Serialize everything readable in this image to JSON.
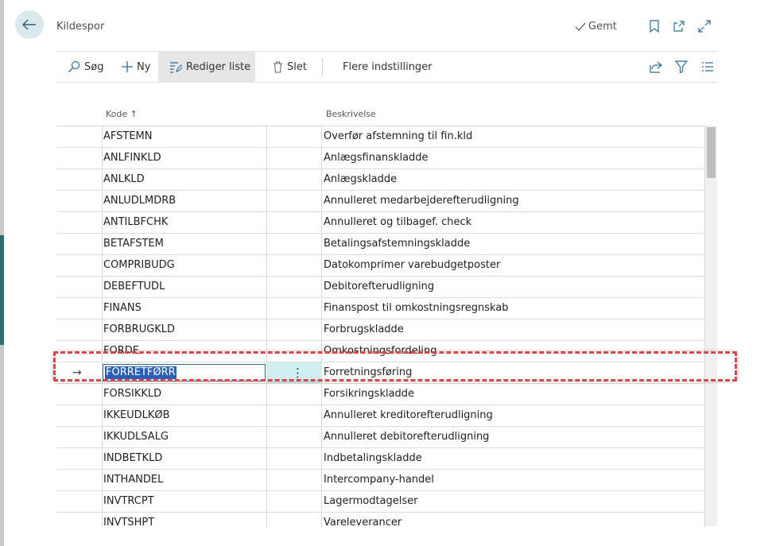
{
  "header": {
    "title": "Kildespor",
    "saved_label": "Gemt"
  },
  "toolbar": {
    "search_label": "Søg",
    "new_label": "Ny",
    "edit_list_label": "Rediger liste",
    "delete_label": "Slet",
    "more_settings_label": "Flere indstillinger"
  },
  "columns": {
    "code": "Kode ↑",
    "description": "Beskrivelse"
  },
  "rows": [
    {
      "code": "AFSTEMN",
      "desc": "Overfør afstemning til fin.kld"
    },
    {
      "code": "ANLFINKLD",
      "desc": "Anlægsfinanskladde"
    },
    {
      "code": "ANLKLD",
      "desc": "Anlægskladde"
    },
    {
      "code": "ANLUDLMDRB",
      "desc": "Annulleret medarbejderefterudligning"
    },
    {
      "code": "ANTILBFCHK",
      "desc": "Annulleret og tilbagef. check"
    },
    {
      "code": "BETAFSTEM",
      "desc": "Betalingsafstemningskladde"
    },
    {
      "code": "COMPRIBUDG",
      "desc": "Datokomprimer varebudgetposter"
    },
    {
      "code": "DEBEFTUDL",
      "desc": "Debitorefterudligning"
    },
    {
      "code": "FINANS",
      "desc": "Finanspost til omkostningsregnskab"
    },
    {
      "code": "FORBRUGKLD",
      "desc": "Forbrugskladde"
    },
    {
      "code": "FORDE",
      "desc": "Omkostningsfordeling"
    },
    {
      "code": "FORRETFØRR",
      "desc": "Forretningsføring"
    },
    {
      "code": "FORSIKKLD",
      "desc": "Forsikringskladde"
    },
    {
      "code": "IKKEUDLKØB",
      "desc": "Annulleret kreditorefterudligning"
    },
    {
      "code": "IKKUDLSALG",
      "desc": "Annulleret debitorefterudligning"
    },
    {
      "code": "INDBETKLD",
      "desc": "Indbetalingskladde"
    },
    {
      "code": "INTHANDEL",
      "desc": "Intercompany-handel"
    },
    {
      "code": "INVTRCPT",
      "desc": "Lagermodtagelser"
    },
    {
      "code": "INVTSHPT",
      "desc": "Vareleverancer"
    }
  ],
  "icons": {
    "back": "arrow-left-icon",
    "saved": "checkmark-icon",
    "bookmark": "bookmark-icon",
    "open_new": "open-in-new-icon",
    "expand": "expand-icon",
    "search": "search-icon",
    "new": "plus-icon",
    "edit_list": "edit-list-icon",
    "delete": "trash-icon",
    "share": "share-icon",
    "filter": "filter-icon",
    "list": "list-view-icon",
    "row_indicator": "arrow-right-icon",
    "row_menu": "more-vertical-icon"
  },
  "colors": {
    "selected_text_bg": "#2b5fb3",
    "selected_row_bg": "#d0edef",
    "highlight_border": "#d9474a"
  }
}
